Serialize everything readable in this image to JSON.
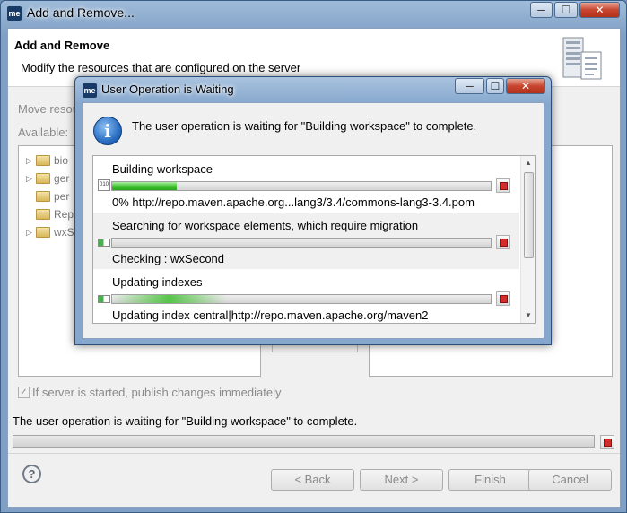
{
  "window": {
    "app_icon": "me",
    "title": "Add and Remove...",
    "controls": {
      "minimize": "─",
      "maximize": "☐",
      "close": "✕"
    }
  },
  "banner": {
    "title": "Add and Remove",
    "description": "Modify the resources that are configured on the server"
  },
  "move_label": "Move resou",
  "available_label": "Available:",
  "available_items": [
    "bio",
    "ger",
    "per",
    "Rep",
    "wxS"
  ],
  "publish_checkbox": {
    "label": "If server is started, publish changes immediately",
    "checked": true
  },
  "status_message": "The user operation is waiting for \"Building workspace\" to complete.",
  "buttons": {
    "back": "< Back",
    "next": "Next >",
    "finish": "Finish",
    "cancel": "Cancel"
  },
  "dialog": {
    "app_icon": "me",
    "title": "User Operation is Waiting",
    "message": "The user operation is waiting for \"Building workspace\" to complete.",
    "jobs": [
      {
        "name": "Building workspace",
        "detail": "0% http://repo.maven.apache.org...lang3/3.4/commons-lang3-3.4.pom",
        "progress": 0.17,
        "icon": "build-icon"
      },
      {
        "name": "Searching for workspace elements, which require migration",
        "detail": "Checking : wxSecond",
        "progress": 0,
        "icon": "progress-icon"
      },
      {
        "name": "Updating indexes",
        "detail": "Updating index central|http://repo.maven.apache.org/maven2",
        "progress": 0.3,
        "icon": "progress-icon"
      }
    ]
  }
}
